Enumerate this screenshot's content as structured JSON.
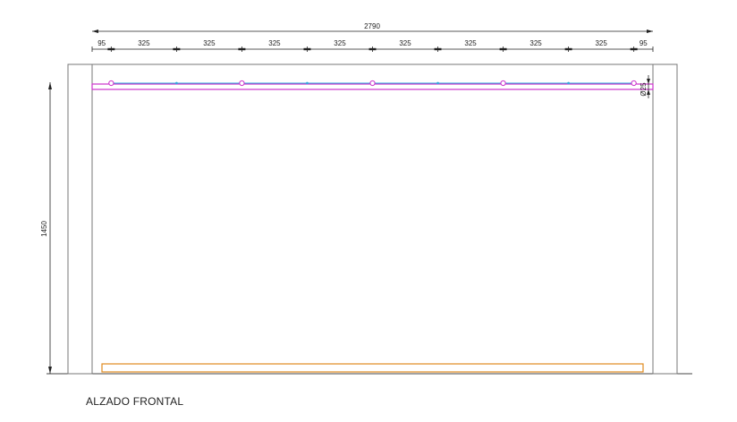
{
  "drawing": {
    "title": "ALZADO FRONTAL",
    "overall_width": "2790",
    "segments": [
      "95",
      "325",
      "325",
      "325",
      "325",
      "325",
      "325",
      "325",
      "325",
      "95"
    ],
    "height": "1450",
    "pipe_diameter": "Ø25",
    "colors": {
      "line": "#333333",
      "frame_gray": "#888888",
      "pipe": "#cc33cc",
      "nozzle": "#33aadd",
      "base": "#e08a1e"
    }
  }
}
